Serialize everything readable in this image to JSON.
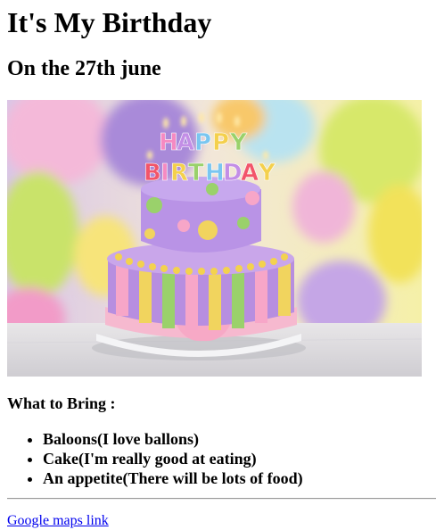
{
  "header": {
    "title": "It's My Birthday",
    "subtitle": "On the 27th june"
  },
  "hero_image": {
    "icon": "birthday-cake-photo",
    "candle_text": [
      "HAPPY",
      "BIRTHDAY"
    ]
  },
  "bring": {
    "heading": "What to Bring :",
    "items": [
      "Baloons(I love ballons)",
      "Cake(I'm really good at eating)",
      "An appetite(There will be lots of food)"
    ]
  },
  "footer": {
    "maps_link_label": "Google maps link"
  },
  "colors": {
    "link": "#0000ee",
    "divider": "#9a9a9a"
  }
}
